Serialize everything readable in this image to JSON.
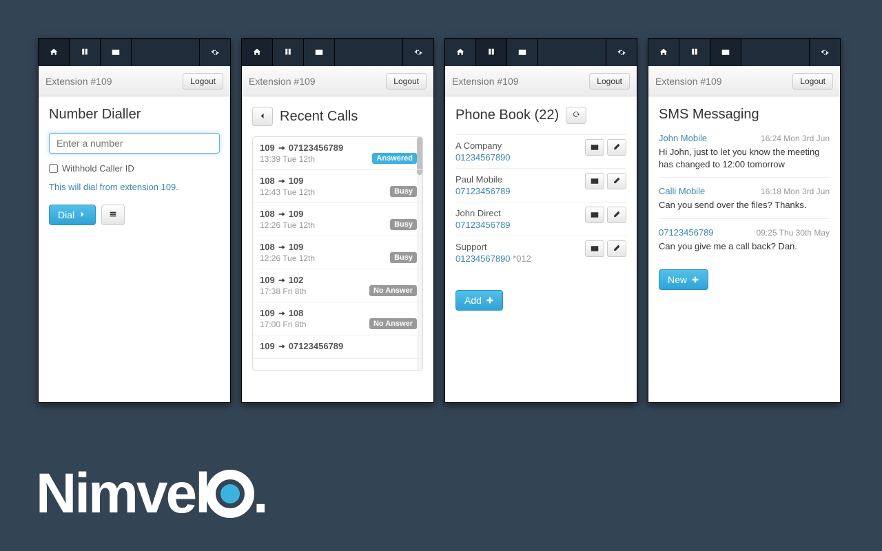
{
  "subhead": {
    "extension": "Extension #109",
    "logout": "Logout"
  },
  "panel1": {
    "title": "Number Dialler",
    "placeholder": "Enter a number",
    "withhold": "Withhold Caller ID",
    "hint": "This will dial from extension 109.",
    "dial": "Dial"
  },
  "panel2": {
    "title": "Recent Calls",
    "calls": [
      {
        "from": "109",
        "to": "07123456789",
        "time": "13:39 Tue 12th",
        "status": "Answered",
        "cls": "answered"
      },
      {
        "from": "108",
        "to": "109",
        "time": "12:43 Tue 12th",
        "status": "Busy",
        "cls": "busy"
      },
      {
        "from": "108",
        "to": "109",
        "time": "12:26 Tue 12th",
        "status": "Busy",
        "cls": "busy"
      },
      {
        "from": "108",
        "to": "109",
        "time": "12:26 Tue 12th",
        "status": "Busy",
        "cls": "busy"
      },
      {
        "from": "109",
        "to": "102",
        "time": "17:38 Fri 8th",
        "status": "No Answer",
        "cls": "noanswer"
      },
      {
        "from": "109",
        "to": "108",
        "time": "17:00 Fri 8th",
        "status": "No Answer",
        "cls": "noanswer"
      },
      {
        "from": "109",
        "to": "07123456789",
        "time": "",
        "status": "",
        "cls": "noanswer"
      }
    ]
  },
  "panel3": {
    "title": "Phone Book (22)",
    "add": "Add",
    "entries": [
      {
        "name": "A Company",
        "num": "01234567890",
        "ext": ""
      },
      {
        "name": "Paul Mobile",
        "num": "07123456789",
        "ext": ""
      },
      {
        "name": "John Direct",
        "num": "07123456789",
        "ext": ""
      },
      {
        "name": "Support",
        "num": "01234567890",
        "ext": " *012"
      }
    ]
  },
  "panel4": {
    "title": "SMS Messaging",
    "new": "New",
    "msgs": [
      {
        "from": "John Mobile",
        "time": "16:24 Mon 3rd Jun",
        "body": "Hi John, just to let you know the meeting has changed to 12:00 tomorrow"
      },
      {
        "from": "Calli Mobile",
        "time": "16:18 Mon 3rd Jun",
        "body": "Can you send over the files? Thanks."
      },
      {
        "from": "07123456789",
        "time": "09:25 Thu 30th May",
        "body": "Can you give me a call back? Dan."
      }
    ]
  },
  "brand": "Nimvel"
}
